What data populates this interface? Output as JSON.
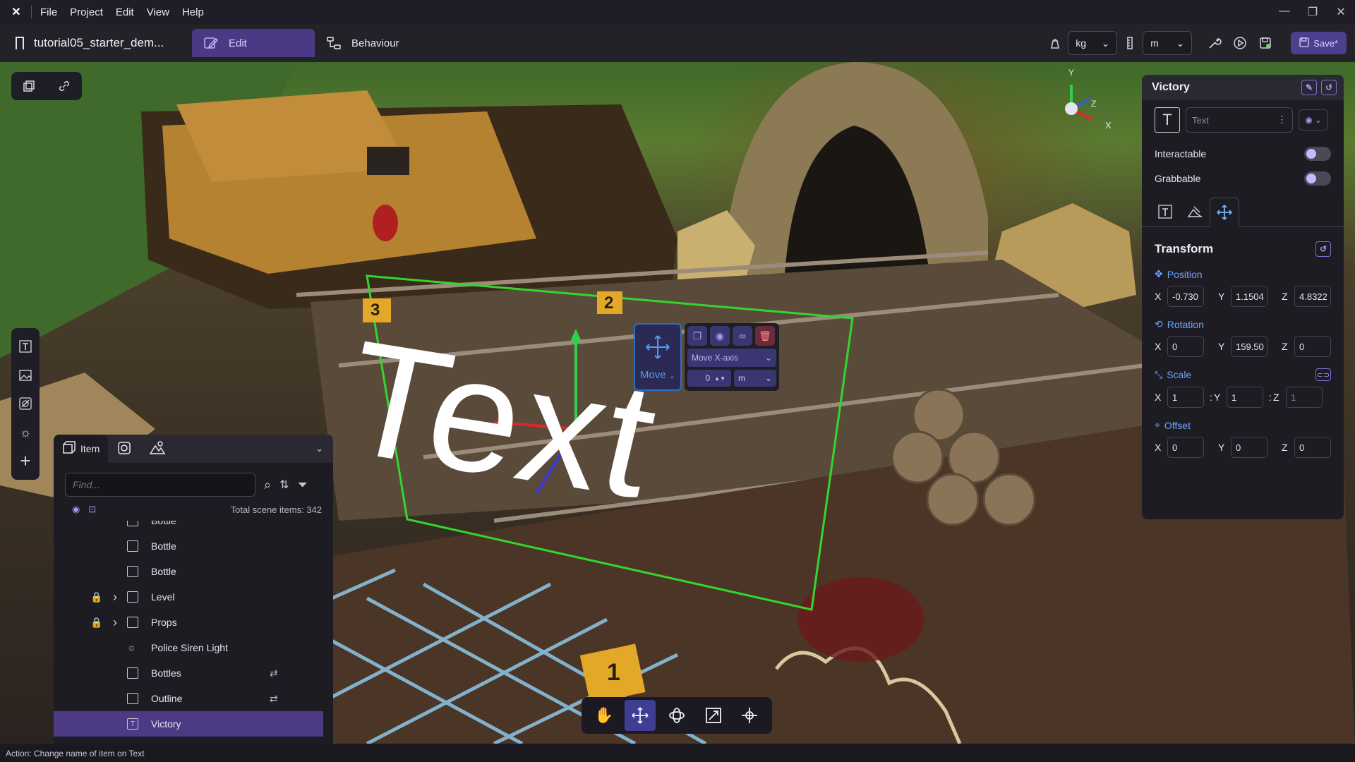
{
  "menu": {
    "items": [
      "File",
      "Project",
      "Edit",
      "View",
      "Help"
    ]
  },
  "window_controls": {
    "minimize": "—",
    "restore": "❐",
    "close": "✕"
  },
  "toolbar": {
    "doc_title": "tutorial05_starter_dem...",
    "tabs": [
      {
        "label": "Edit"
      },
      {
        "label": "Behaviour"
      }
    ],
    "mass_unit": "kg",
    "length_unit": "m",
    "save_label": "Save*"
  },
  "scene": {
    "text_label": "Text",
    "markers": [
      "3",
      "2",
      "1"
    ],
    "gizmo_axes": {
      "x": "X",
      "y": "Y",
      "z": "Z"
    }
  },
  "move_widget": {
    "label": "Move",
    "axis_option": "Move X-axis",
    "step_value": "0",
    "step_unit": "m"
  },
  "item_panel": {
    "tabs": [
      {
        "label": "Item"
      }
    ],
    "search_placeholder": "Find...",
    "total_items": "Total scene items: 342",
    "tree": [
      {
        "name": "Bottle",
        "type": "box",
        "lock": false,
        "expand": false,
        "behaviour": false
      },
      {
        "name": "Bottle",
        "type": "box",
        "lock": false,
        "expand": false,
        "behaviour": false
      },
      {
        "name": "Bottle",
        "type": "box",
        "lock": false,
        "expand": false,
        "behaviour": false
      },
      {
        "name": "Level",
        "type": "box",
        "lock": true,
        "expand": true,
        "behaviour": false
      },
      {
        "name": "Props",
        "type": "box",
        "lock": true,
        "expand": true,
        "behaviour": false
      },
      {
        "name": "Police Siren Light",
        "type": "light",
        "lock": false,
        "expand": false,
        "behaviour": false
      },
      {
        "name": "Bottles",
        "type": "box",
        "lock": false,
        "expand": false,
        "behaviour": true
      },
      {
        "name": "Outline",
        "type": "box",
        "lock": false,
        "expand": false,
        "behaviour": true
      },
      {
        "name": "Victory",
        "type": "text",
        "lock": false,
        "expand": false,
        "behaviour": false,
        "selected": true
      }
    ]
  },
  "properties": {
    "title": "Victory",
    "item_type": "Text",
    "interactable_label": "Interactable",
    "grabbable_label": "Grabbable",
    "transform": {
      "title": "Transform",
      "position": {
        "label": "Position",
        "x": "-0.730",
        "y": "1.1504",
        "z": "4.8322"
      },
      "rotation": {
        "label": "Rotation",
        "x": "0",
        "y": "159.50",
        "z": "0"
      },
      "scale": {
        "label": "Scale",
        "x": "1",
        "y": "1",
        "z": "1"
      },
      "offset": {
        "label": "Offset",
        "x": "0",
        "y": "0",
        "z": "0"
      }
    }
  },
  "status": {
    "text": "Action: Change name of item on Text"
  },
  "colors": {
    "accent": "#4a3a86",
    "selection": "#4c3a85",
    "bbox": "#34d62e",
    "blue": "#6ea3ff"
  }
}
